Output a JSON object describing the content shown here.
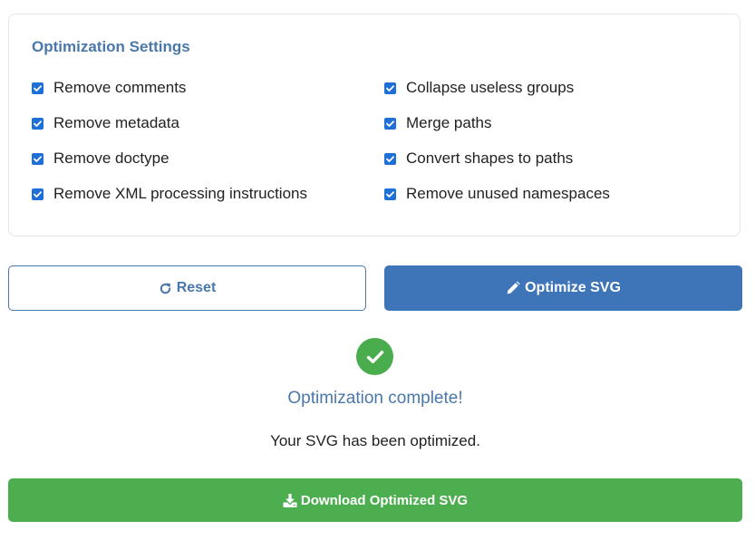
{
  "settings": {
    "title": "Optimization Settings",
    "options": [
      {
        "label": "Remove comments",
        "checked": true
      },
      {
        "label": "Collapse useless groups",
        "checked": true
      },
      {
        "label": "Remove metadata",
        "checked": true
      },
      {
        "label": "Merge paths",
        "checked": true
      },
      {
        "label": "Remove doctype",
        "checked": true
      },
      {
        "label": "Convert shapes to paths",
        "checked": true
      },
      {
        "label": "Remove XML processing instructions",
        "checked": true
      },
      {
        "label": "Remove unused namespaces",
        "checked": true
      }
    ]
  },
  "actions": {
    "reset_label": "Reset",
    "reset_icon": "redo-icon",
    "optimize_label": "Optimize SVG",
    "optimize_icon": "pencil-icon"
  },
  "status": {
    "icon": "check-circle-icon",
    "title": "Optimization complete!",
    "message": "Your SVG has been optimized."
  },
  "download": {
    "label": "Download Optimized SVG",
    "icon": "download-icon"
  },
  "colors": {
    "accent": "#4a78ab",
    "primary_button": "#3e74b8",
    "success": "#4cae4f",
    "checkbox": "#1f6fd8"
  }
}
